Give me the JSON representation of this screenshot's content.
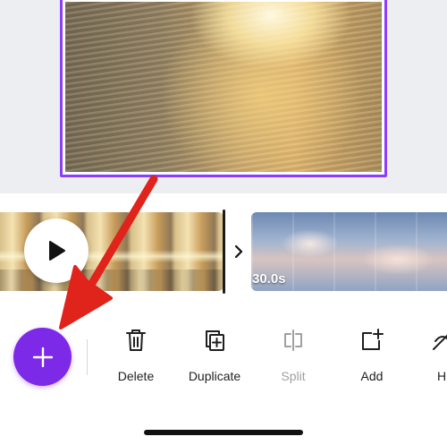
{
  "timeline": {
    "clip_duration": "30.0s"
  },
  "toolbar": {
    "tools": [
      {
        "label": "Delete",
        "icon": "trash-icon",
        "enabled": true
      },
      {
        "label": "Duplicate",
        "icon": "duplicate-icon",
        "enabled": true
      },
      {
        "label": "Split",
        "icon": "split-icon",
        "enabled": false
      },
      {
        "label": "Add",
        "icon": "add-page-icon",
        "enabled": true
      },
      {
        "label": "H",
        "icon": "hide-icon",
        "enabled": true
      }
    ]
  },
  "colors": {
    "accent": "#7d2ae8",
    "selection_border": "#8b3dff",
    "annotation_arrow": "#e0231b"
  }
}
